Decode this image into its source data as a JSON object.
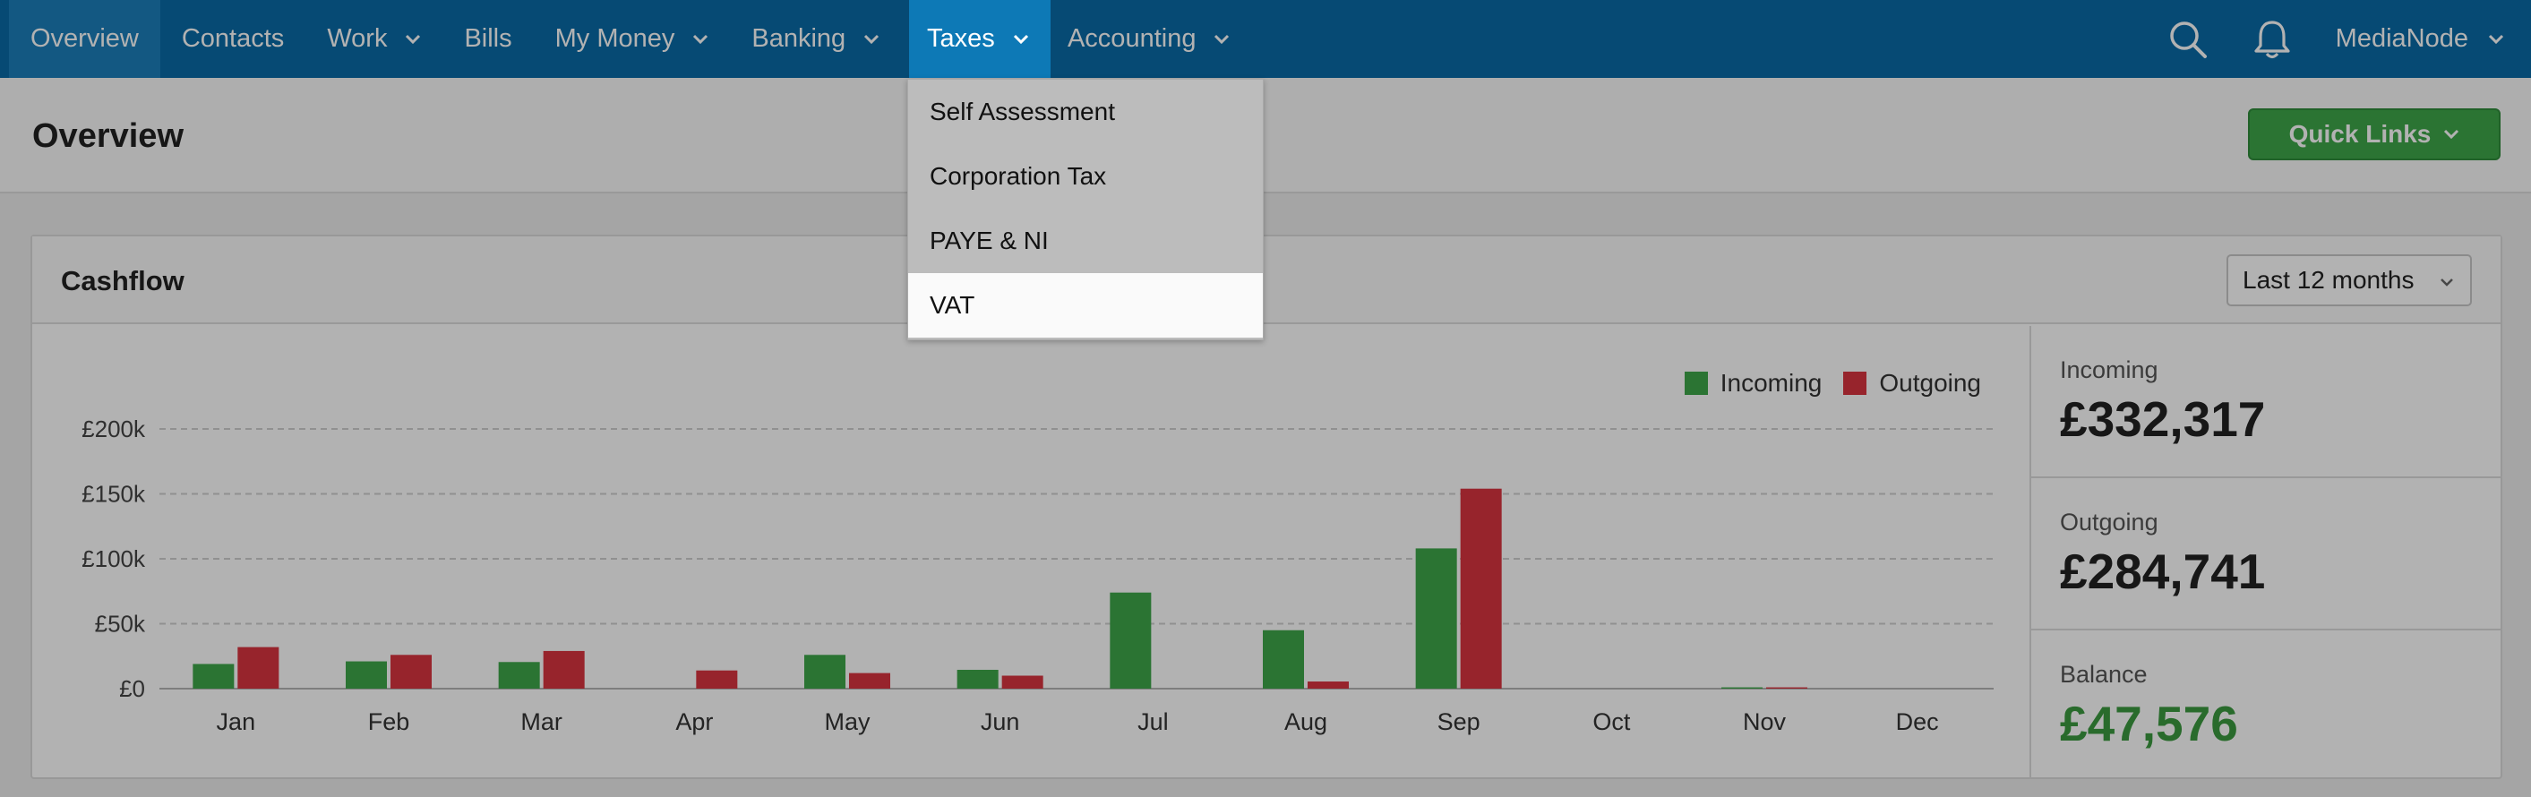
{
  "nav": {
    "items": [
      {
        "label": "Overview",
        "has_chevron": false
      },
      {
        "label": "Contacts",
        "has_chevron": false
      },
      {
        "label": "Work",
        "has_chevron": true
      },
      {
        "label": "Bills",
        "has_chevron": false
      },
      {
        "label": "My Money",
        "has_chevron": true
      },
      {
        "label": "Banking",
        "has_chevron": true
      },
      {
        "label": "Taxes",
        "has_chevron": true
      },
      {
        "label": "Accounting",
        "has_chevron": true
      }
    ],
    "account_label": "MediaNode",
    "search_icon": "search-icon",
    "bell_icon": "bell-icon"
  },
  "page": {
    "title": "Overview",
    "quick_links_label": "Quick Links"
  },
  "taxes_menu": {
    "items": [
      "Self Assessment",
      "Corporation Tax",
      "PAYE & NI",
      "VAT"
    ],
    "highlighted": "VAT"
  },
  "cashflow": {
    "title": "Cashflow",
    "period": "Last 12 months",
    "stats": {
      "incoming_label": "Incoming",
      "incoming_value": "£332,317",
      "outgoing_label": "Outgoing",
      "outgoing_value": "£284,741",
      "balance_label": "Balance",
      "balance_value": "£47,576"
    }
  },
  "colors": {
    "nav_bg": "#0a6aa6",
    "incoming": "#3ea64a",
    "outgoing": "#d9343f",
    "quick_links": "#3ea64a",
    "balance": "#3b9a3f"
  },
  "chart_data": {
    "type": "bar",
    "categories": [
      "Jan",
      "Feb",
      "Mar",
      "Apr",
      "May",
      "Jun",
      "Jul",
      "Aug",
      "Sep",
      "Oct",
      "Nov",
      "Dec"
    ],
    "series": [
      {
        "name": "Incoming",
        "values": [
          19000,
          21000,
          20500,
          0,
          26000,
          14500,
          74000,
          45000,
          108000,
          0,
          1000,
          0
        ]
      },
      {
        "name": "Outgoing",
        "values": [
          32000,
          26000,
          29000,
          14000,
          12000,
          10000,
          0,
          5500,
          154000,
          0,
          1000,
          0
        ]
      }
    ],
    "ylim": [
      0,
      200000
    ],
    "yticks": [
      0,
      50000,
      100000,
      150000,
      200000
    ],
    "ytick_labels": [
      "£0",
      "£50k",
      "£100k",
      "£150k",
      "£200k"
    ],
    "grid": true,
    "legend_position": "top-right"
  }
}
